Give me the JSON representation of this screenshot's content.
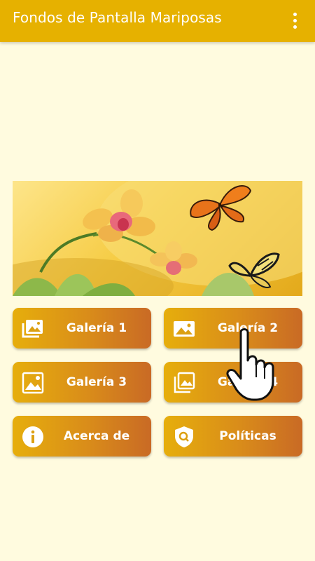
{
  "app": {
    "title": "Fondos de Pantalla Mariposas",
    "menu_icon": "more-vert-icon",
    "accent_color": "#e6b100",
    "background_color": "#fffbdf"
  },
  "banner": {
    "description_icon": "butterfly-orchid-banner"
  },
  "buttons": {
    "galeria1": {
      "label": "Galería 1",
      "icon": "photo-library-icon"
    },
    "galeria2": {
      "label": "Galería 2",
      "icon": "image-icon"
    },
    "galeria3": {
      "label": "Galería 3",
      "icon": "landscape-photo-icon"
    },
    "galeria4": {
      "label": "Galería 4",
      "icon": "photo-stack-icon"
    },
    "acerca": {
      "label": "Acerca de",
      "icon": "info-icon"
    },
    "politicas": {
      "label": "Políticas",
      "icon": "shield-search-icon"
    }
  },
  "overlay": {
    "icon": "pointing-hand-cursor-icon"
  }
}
